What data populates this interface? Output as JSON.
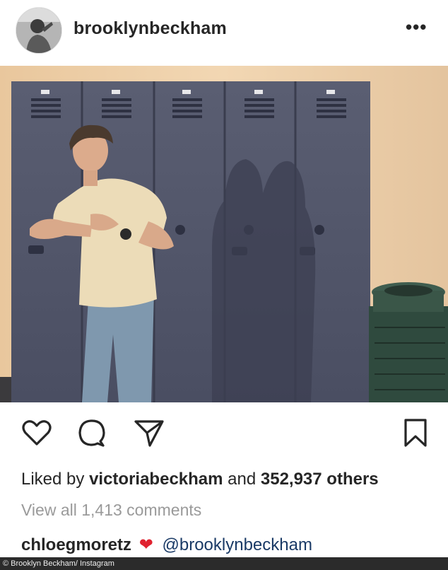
{
  "post": {
    "username": "brooklynbeckham",
    "more_label": "•••"
  },
  "actions": {
    "like_icon": "heart-outline-icon",
    "comment_icon": "comment-bubble-icon",
    "share_icon": "paper-plane-icon",
    "save_icon": "bookmark-icon"
  },
  "likes": {
    "prefix": "Liked by",
    "user": "victoriabeckham",
    "joiner": "and",
    "count": "352,937 others"
  },
  "comments_link": "View all 1,413 comments",
  "comment": {
    "user": "chloegmoretz",
    "emoji": "❤",
    "mention": "@brooklynbeckham"
  },
  "credit": "© Brooklyn Beckham/ Instagram",
  "colors": {
    "heart_red": "#e0222f",
    "mention_blue": "#1a3a66",
    "muted_gray": "#9a9a9a"
  }
}
